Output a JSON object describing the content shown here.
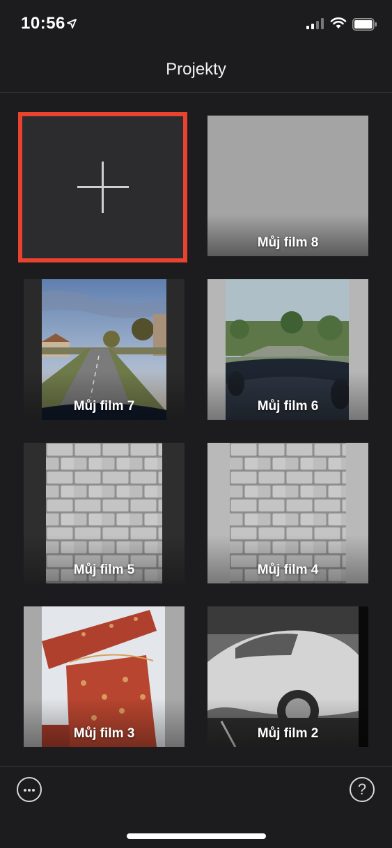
{
  "status_bar": {
    "time": "10:56",
    "icons": [
      "location-arrow-icon",
      "cellular-signal-icon",
      "wifi-icon",
      "battery-icon"
    ]
  },
  "nav": {
    "title": "Projekty"
  },
  "new_project": {
    "icon": "plus-icon",
    "highlight_color": "#e8432f"
  },
  "projects": [
    {
      "title": "Můj film 8",
      "thumbnail": "gray-blank"
    },
    {
      "title": "Můj film 7",
      "thumbnail": "road-village-sky"
    },
    {
      "title": "Můj film 6",
      "thumbnail": "road-from-car-dashboard"
    },
    {
      "title": "Můj film 5",
      "thumbnail": "paving-stones"
    },
    {
      "title": "Můj film 4",
      "thumbnail": "paving-stones"
    },
    {
      "title": "Můj film 3",
      "thumbnail": "red-gift-wrapping-paper"
    },
    {
      "title": "Můj film 2",
      "thumbnail": "silver-car-black-and-white"
    }
  ],
  "toolbar": {
    "more_icon": "ellipsis-circle-icon",
    "help_icon": "question-circle-icon",
    "help_label": "?"
  },
  "colors": {
    "background": "#1c1c1e",
    "accent": "#e8432f"
  }
}
